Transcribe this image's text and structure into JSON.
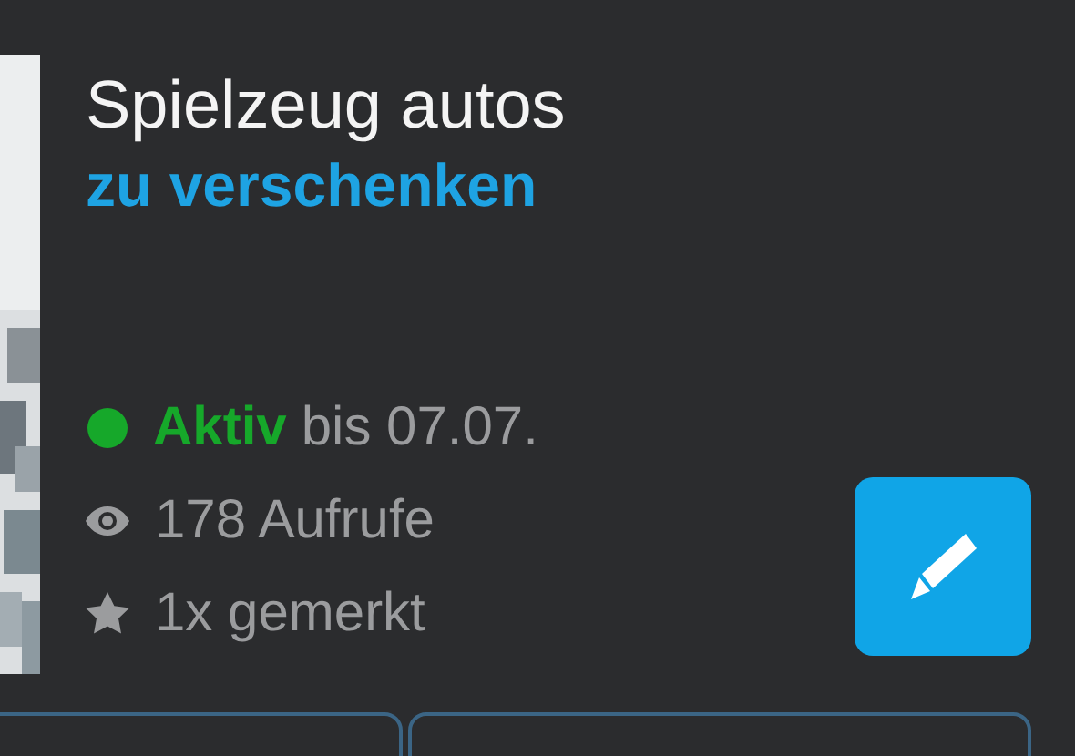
{
  "listing": {
    "title": "Spielzeug autos",
    "subtitle": "zu verschenken"
  },
  "status": {
    "label": "Aktiv",
    "color": "#16a82a",
    "until": "bis 07.07."
  },
  "views": "178 Aufrufe",
  "bookmarks": "1x gemerkt"
}
